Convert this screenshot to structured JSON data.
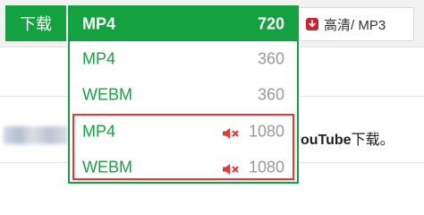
{
  "toolbar": {
    "download_label": "下载",
    "hq_label": "高清/ MP3",
    "hq_icon": "download-arrow-icon"
  },
  "page": {
    "description_brand": "ouTube",
    "description_suffix": "下载。"
  },
  "dropdown": {
    "selected": {
      "format": "MP4",
      "resolution": "720"
    },
    "options": [
      {
        "format": "MP4",
        "resolution": "360",
        "muted": false
      },
      {
        "format": "WEBM",
        "resolution": "360",
        "muted": false
      },
      {
        "format": "MP4",
        "resolution": "1080",
        "muted": true
      },
      {
        "format": "WEBM",
        "resolution": "1080",
        "muted": true
      }
    ]
  },
  "colors": {
    "accent_green": "#14a240",
    "highlight_red": "#e53935",
    "mute_icon_red": "#e53935",
    "muted_text_gray": "#999999"
  }
}
